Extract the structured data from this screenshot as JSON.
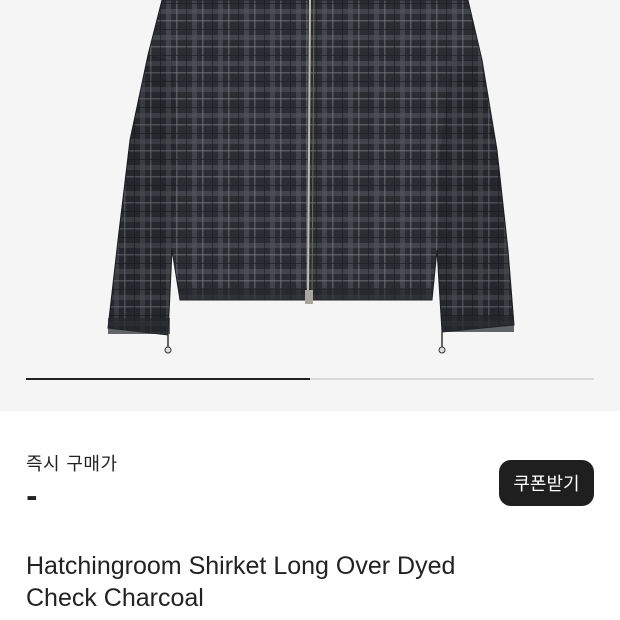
{
  "gallery": {
    "image_alt": "charcoal check zip jacket",
    "progress_fraction": 0.5
  },
  "price": {
    "label": "즉시 구매가",
    "value": "-"
  },
  "coupon": {
    "label": "쿠폰받기"
  },
  "product": {
    "title_line1": "Hatchingroom Shirket Long Over Dyed",
    "title_line2": "Check Charcoal"
  },
  "colors": {
    "background": "#f5f5f5",
    "fabric_dark": "#2b2d33",
    "fabric_check": "#55575e",
    "button_bg": "#1f1f1f",
    "text": "#222222"
  }
}
